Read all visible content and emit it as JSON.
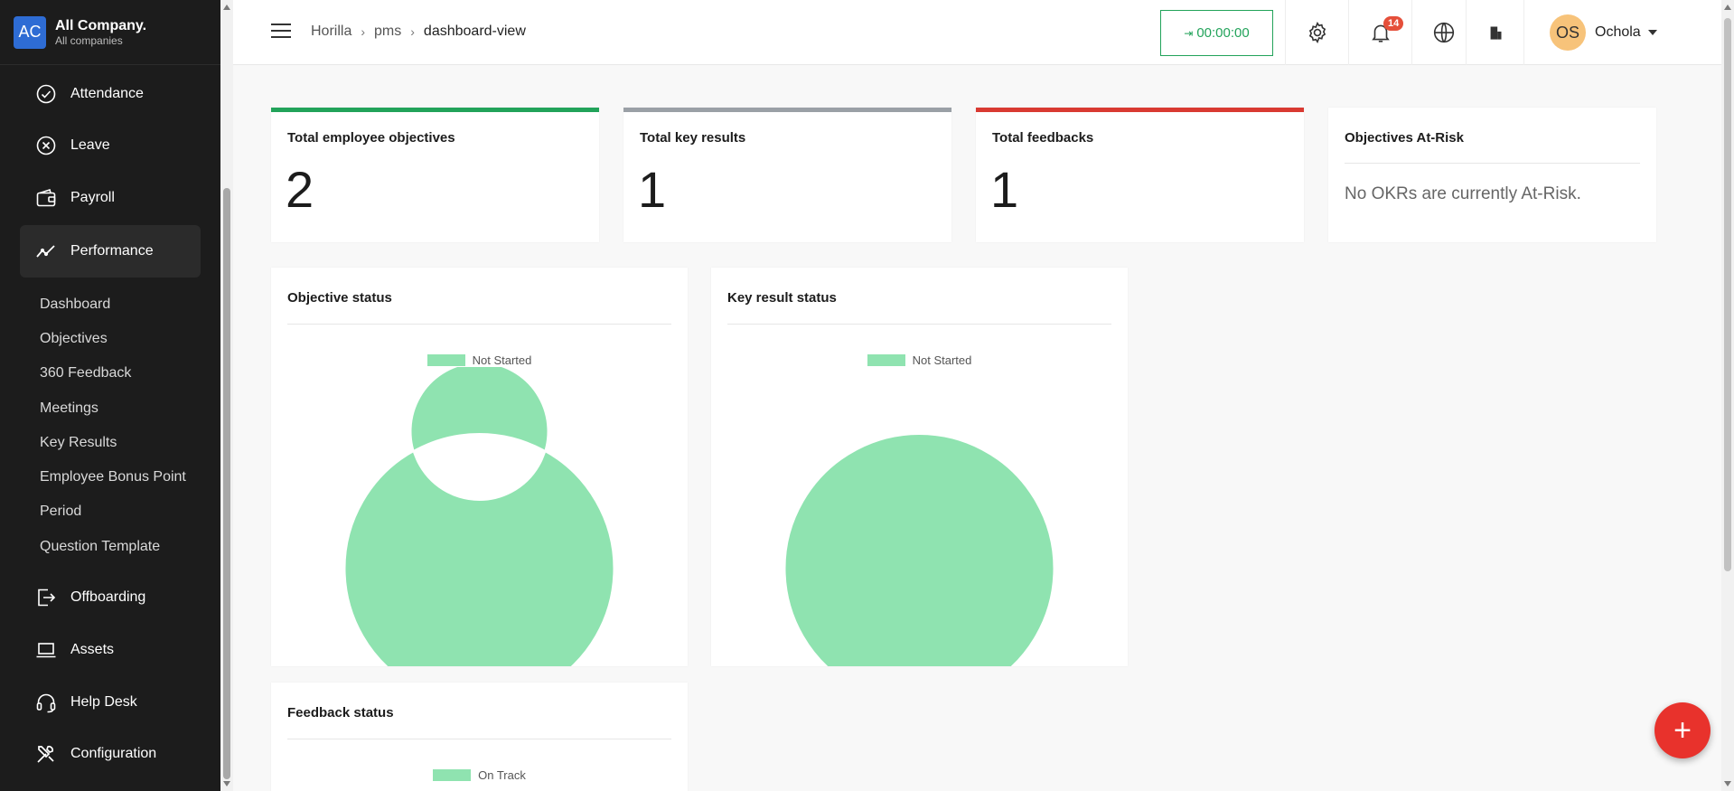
{
  "company": {
    "initials": "AC",
    "name": "All Company.",
    "subtitle": "All companies"
  },
  "sidebar": {
    "items": [
      {
        "label": "Attendance",
        "icon": "check-circle-icon"
      },
      {
        "label": "Leave",
        "icon": "x-circle-icon"
      },
      {
        "label": "Payroll",
        "icon": "wallet-icon"
      },
      {
        "label": "Performance",
        "icon": "trend-line-icon",
        "active": true
      },
      {
        "label": "Offboarding",
        "icon": "exit-icon"
      },
      {
        "label": "Assets",
        "icon": "laptop-icon"
      },
      {
        "label": "Help Desk",
        "icon": "headset-icon"
      },
      {
        "label": "Configuration",
        "icon": "tools-icon"
      }
    ],
    "performance_sub": [
      "Dashboard",
      "Objectives",
      "360 Feedback",
      "Meetings",
      "Key Results",
      "Employee Bonus Point",
      "Period",
      "Question Template"
    ]
  },
  "header": {
    "breadcrumb": [
      "Horilla",
      "pms",
      "dashboard-view"
    ],
    "timer": "00:00:00",
    "notifications_count": "14",
    "user": {
      "initials": "OS",
      "name": "Ochola"
    }
  },
  "stats": [
    {
      "title": "Total employee objectives",
      "value": "2",
      "color": "#22a35a"
    },
    {
      "title": "Total key results",
      "value": "1",
      "color": "#9aa0a6"
    },
    {
      "title": "Total feedbacks",
      "value": "1",
      "color": "#d93a32"
    }
  ],
  "at_risk": {
    "title": "Objectives At-Risk",
    "message": "No OKRs are currently At-Risk."
  },
  "chart_data": [
    {
      "type": "pie",
      "title": "Objective status",
      "variant": "doughnut",
      "labels": [
        "Not Started"
      ],
      "values": [
        2
      ],
      "colors": [
        "#8fe3b0"
      ],
      "legend_position": "top"
    },
    {
      "type": "pie",
      "title": "Key result status",
      "variant": "pie",
      "labels": [
        "Not Started"
      ],
      "values": [
        1
      ],
      "colors": [
        "#8fe3b0"
      ],
      "legend_position": "top"
    },
    {
      "type": "pie",
      "title": "Feedback status",
      "variant": "pie",
      "labels": [
        "On Track"
      ],
      "values": [
        1
      ],
      "colors": [
        "#8fe3b0"
      ],
      "legend_position": "top"
    }
  ]
}
